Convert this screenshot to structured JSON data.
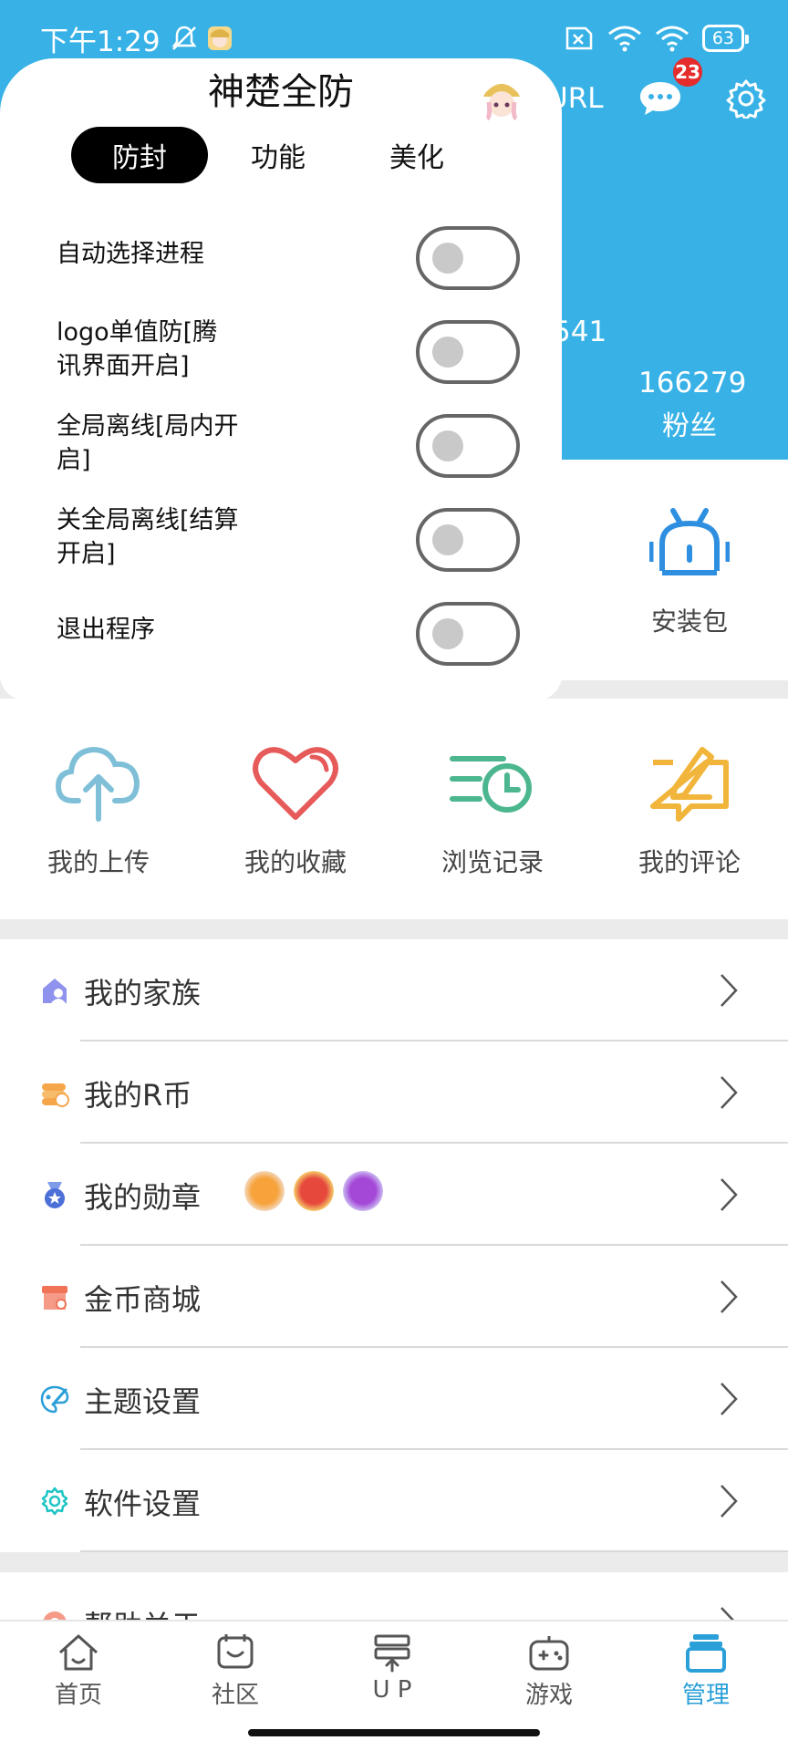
{
  "status_bar": {
    "time": "下午1:29",
    "battery": "63"
  },
  "header": {
    "url_label": "URL",
    "message_badge": "23",
    "partial_stat": "541",
    "fans_count": "166279",
    "fans_label": "粉丝"
  },
  "quick_icons": {
    "install_label": "安装包"
  },
  "shortcuts": [
    {
      "label": "我的上传",
      "icon": "cloud-upload-icon",
      "color": "#7fc0d8"
    },
    {
      "label": "我的收藏",
      "icon": "heart-icon",
      "color": "#e65a5a"
    },
    {
      "label": "浏览记录",
      "icon": "history-icon",
      "color": "#4cb68f"
    },
    {
      "label": "我的评论",
      "icon": "comment-edit-icon",
      "color": "#f2b53c"
    }
  ],
  "menu": [
    {
      "label": "我的家族",
      "icon": "family-icon",
      "color": "#6b6fe0"
    },
    {
      "label": "我的R币",
      "icon": "coin-icon",
      "color": "#f5a64a"
    },
    {
      "label": "我的勋章",
      "icon": "medal-icon",
      "color": "#4d6fd8"
    },
    {
      "label": "金币商城",
      "icon": "store-icon",
      "color": "#f07358"
    },
    {
      "label": "主题设置",
      "icon": "palette-icon",
      "color": "#2a9fd8"
    },
    {
      "label": "软件设置",
      "icon": "settings-icon",
      "color": "#1fc4c4"
    },
    {
      "label": "帮助关于",
      "icon": "help-icon",
      "color": "#f07358"
    }
  ],
  "bottom_nav": [
    {
      "label": "首页",
      "icon": "home-icon"
    },
    {
      "label": "社区",
      "icon": "community-icon"
    },
    {
      "label": "U P",
      "icon": "upload-server-icon"
    },
    {
      "label": "游戏",
      "icon": "gamepad-icon"
    },
    {
      "label": "管理",
      "icon": "manage-icon",
      "active": true
    }
  ],
  "panel": {
    "title": "神楚全防",
    "tabs": [
      "防封",
      "功能",
      "美化"
    ],
    "active_tab": "防封",
    "options": [
      {
        "label": "自动选择进程",
        "enabled": false
      },
      {
        "label": "logo单值防[腾讯界面开启]",
        "enabled": false
      },
      {
        "label": "全局离线[局内开启]",
        "enabled": false
      },
      {
        "label": "关全局离线[结算开启]",
        "enabled": false
      },
      {
        "label": "退出程序",
        "enabled": false
      }
    ]
  },
  "colors": {
    "header_blue": "#38b2e6",
    "active_nav": "#2a9fd8",
    "badge_red": "#e52b2b"
  }
}
